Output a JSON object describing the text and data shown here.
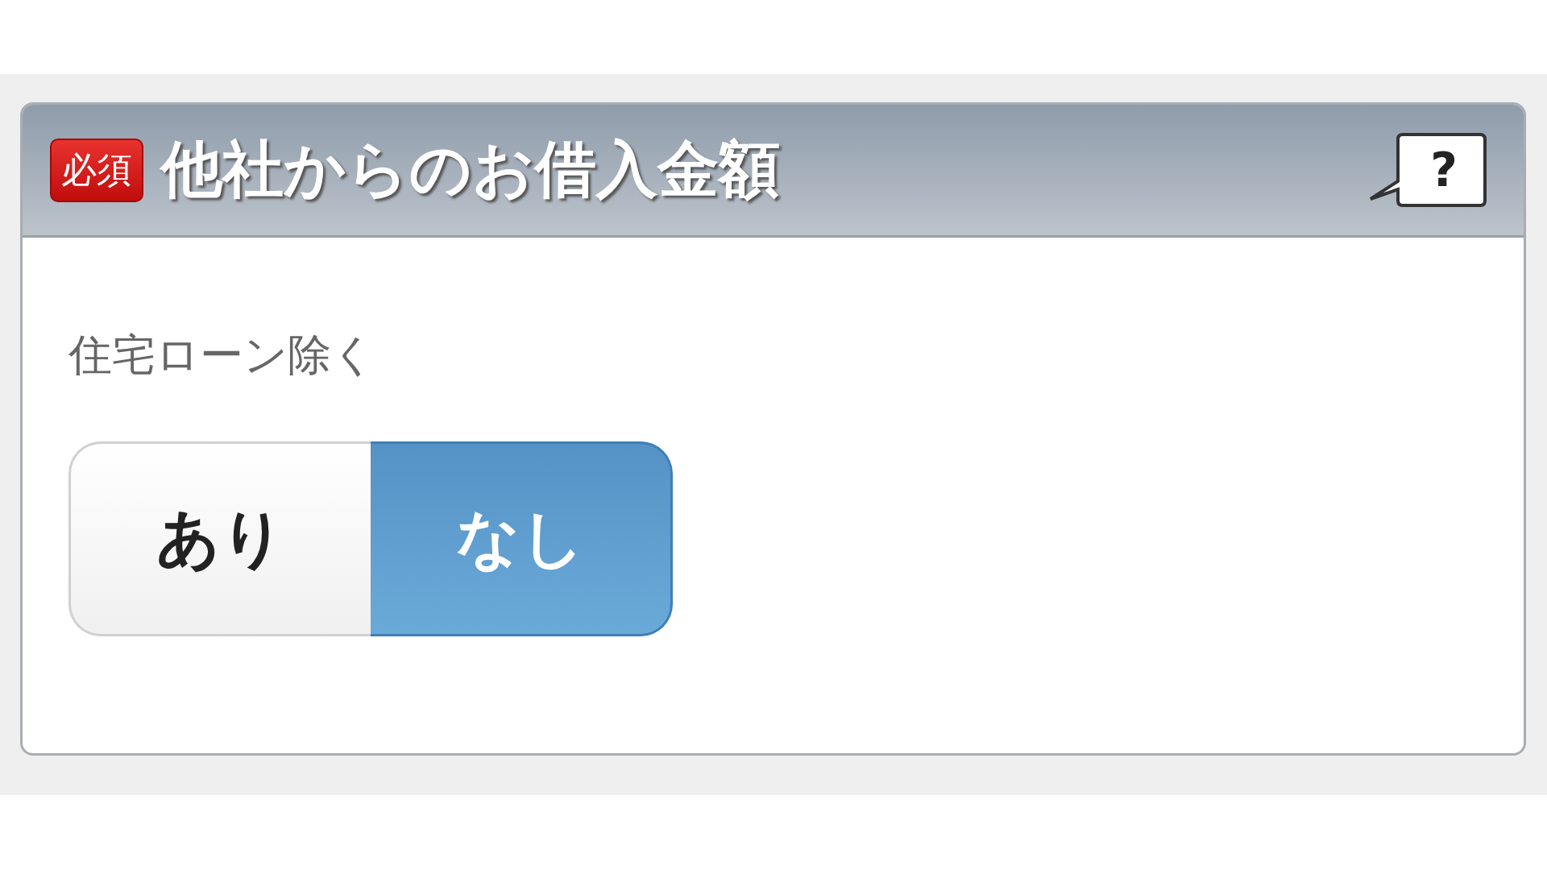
{
  "header": {
    "badge": "必須",
    "title": "他社からのお借入金額",
    "help": "?"
  },
  "note": "住宅ローン除く",
  "options": [
    {
      "label": "あり",
      "selected": false
    },
    {
      "label": "なし",
      "selected": true
    }
  ]
}
